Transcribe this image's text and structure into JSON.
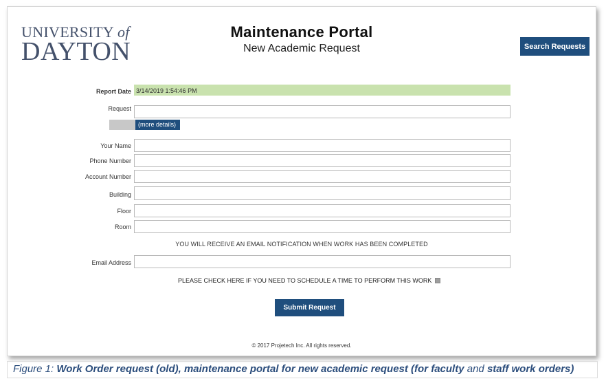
{
  "logo": {
    "line1": "UNIVERSITY",
    "of": "of",
    "line2": "DAYTON"
  },
  "header": {
    "title": "Maintenance Portal",
    "subtitle": "New Academic Request"
  },
  "search_button": "Search Requests",
  "form": {
    "report_date_label": "Report Date",
    "report_date_value": "3/14/2019 1:54:46 PM",
    "request_label": "Request",
    "more_details": "(more details)",
    "your_name_label": "Your Name",
    "phone_label": "Phone Number",
    "account_label": "Account Number",
    "building_label": "Building",
    "floor_label": "Floor",
    "room_label": "Room",
    "email_notice": "YOU WILL RECEIVE AN EMAIL NOTIFICATION WHEN WORK HAS BEEN COMPLETED",
    "email_label": "Email Address",
    "schedule_text": "PLEASE CHECK HERE IF YOU NEED TO SCHEDULE A TIME TO PERFORM THIS WORK",
    "submit": "Submit Request"
  },
  "footer": {
    "copyright": "© 2017 Projetech Inc. All rights reserved."
  },
  "caption": {
    "part1": "Figure 1: ",
    "part2": "Work Order request (old), maintenance portal for new academic request (for faculty",
    "part3": " and ",
    "part4": "staff work orders)"
  },
  "colors": {
    "primary": "#1f4e7d",
    "date_field_bg": "#c9e2ae",
    "logo": "#44516b",
    "caption": "#2b4d7c"
  }
}
